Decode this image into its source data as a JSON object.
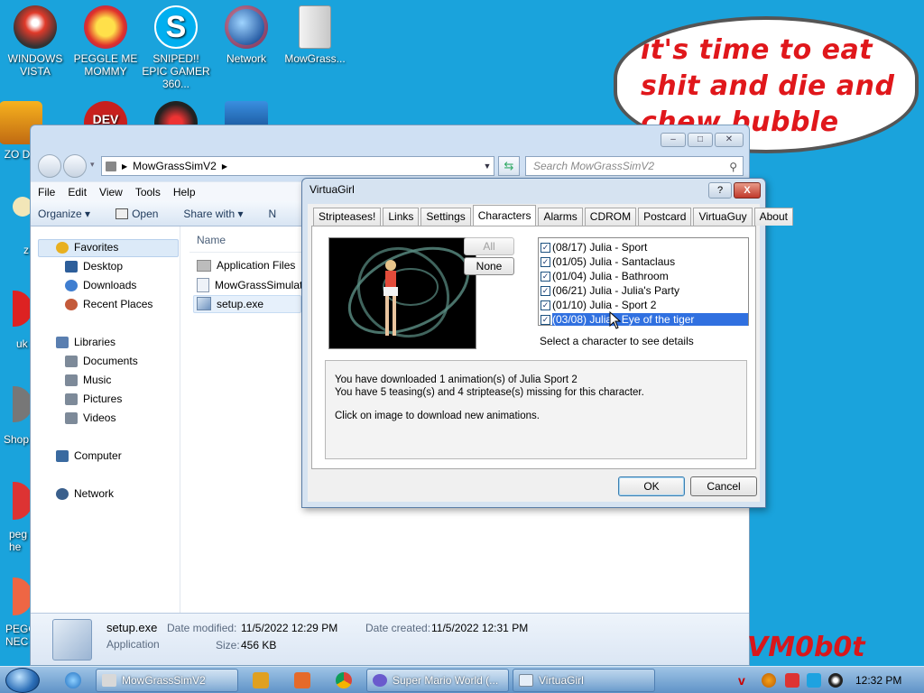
{
  "desktop": {
    "icons": [
      {
        "label": "WINDOWS VISTA",
        "icon": "windows-vista-icon"
      },
      {
        "label": "PEGGLE ME MOMMY",
        "icon": "peggle-icon"
      },
      {
        "label": "SNIPED!! EPIC GAMER 360...",
        "icon": "skype-icon"
      },
      {
        "label": "Network",
        "icon": "network-globe-icon"
      },
      {
        "label": "MowGrass...",
        "icon": "folder-icon"
      }
    ],
    "row2": [
      {
        "label": "ZO DE",
        "icon": "zone-icon"
      },
      {
        "label": "DEV",
        "icon": "dev-icon"
      }
    ],
    "partial_labels": [
      "z",
      "uk",
      "Shop",
      "peg he",
      "PEGG NEC"
    ],
    "bubble_text": "it's time to eat shit and die and chew bubble gum",
    "watermark": "VM0b0t"
  },
  "explorer": {
    "title": "MowGrassSimV2",
    "window_buttons": {
      "minimize": "‒",
      "maximize": "□",
      "close": "✕"
    },
    "address": "MowGrassSimV2",
    "search_placeholder": "Search MowGrassSimV2",
    "menu": [
      "File",
      "Edit",
      "View",
      "Tools",
      "Help"
    ],
    "toolbar": {
      "organize": "Organize ▾",
      "open": "Open",
      "share": "Share with ▾",
      "more": "N"
    },
    "nav": {
      "favorites": "Favorites",
      "favorite_items": [
        "Desktop",
        "Downloads",
        "Recent Places"
      ],
      "libraries": "Libraries",
      "library_items": [
        "Documents",
        "Music",
        "Pictures",
        "Videos"
      ],
      "computer": "Computer",
      "network": "Network"
    },
    "column_name": "Name",
    "files": [
      {
        "name": "Application Files",
        "icon": "folder-icon"
      },
      {
        "name": "MowGrassSimulat",
        "icon": "manifest-icon"
      },
      {
        "name": "setup.exe",
        "icon": "setup-icon"
      }
    ],
    "details": {
      "file_name": "setup.exe",
      "file_type": "Application",
      "modified_label": "Date modified:",
      "modified_value": "11/5/2022 12:29 PM",
      "created_label": "Date created:",
      "created_value": "11/5/2022 12:31 PM",
      "size_label": "Size:",
      "size_value": "456 KB"
    }
  },
  "dialog": {
    "title": "VirtuaGirl",
    "help": "?",
    "close": "X",
    "tabs": [
      "Stripteases!",
      "Links",
      "Settings",
      "Characters",
      "Alarms",
      "CDROM",
      "Postcard",
      "VirtuaGuy",
      "About"
    ],
    "active_tab": "Characters",
    "btn_all": "All",
    "btn_none": "None",
    "characters": [
      {
        "label": "(08/17)  Julia - Sport",
        "checked": true
      },
      {
        "label": "(01/05)  Julia - Santaclaus",
        "checked": true
      },
      {
        "label": "(01/04)  Julia - Bathroom",
        "checked": true
      },
      {
        "label": "(06/21)  Julia - Julia's Party",
        "checked": true
      },
      {
        "label": "(01/10)  Julia - Sport 2",
        "checked": true
      },
      {
        "label": "(03/08)  Julia - Eye of the tiger",
        "checked": true
      }
    ],
    "selected_index": 5,
    "hint": "Select a character to see details",
    "info_lines": [
      "You have downloaded 1 animation(s) of Julia Sport 2",
      "You have 5 teasing(s) and 4 striptease(s) missing for this character.",
      "",
      "Click on image to download new animations."
    ],
    "ok": "OK",
    "cancel": "Cancel"
  },
  "taskbar": {
    "buttons": [
      {
        "label": "MowGrassSimV2",
        "icon": "folder-icon"
      },
      {
        "label": "Super Mario World (...",
        "icon": "snes-icon"
      },
      {
        "label": "VirtuaGirl",
        "icon": "window-icon"
      }
    ],
    "quick_launch": [
      "ie-icon",
      "media-player-icon",
      "paint-icon",
      "chrome-icon"
    ],
    "tray": [
      "virtuagirl-tray-icon",
      "search-tray-icon",
      "flag-tray-icon",
      "monitor-tray-icon",
      "speaker-tray-icon"
    ],
    "clock": "12:32 PM"
  }
}
